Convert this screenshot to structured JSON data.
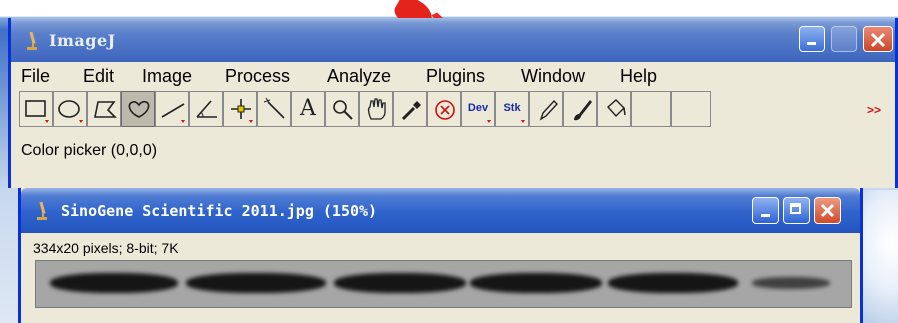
{
  "main_window": {
    "title": "ImageJ",
    "menu": [
      "File",
      "Edit",
      "Image",
      "Process",
      "Analyze",
      "Plugins",
      "Window",
      "Help"
    ],
    "tools": [
      {
        "name": "rectangle-tool",
        "icon": "rectangle-icon",
        "label": ""
      },
      {
        "name": "oval-tool",
        "icon": "oval-icon",
        "label": ""
      },
      {
        "name": "polygon-tool",
        "icon": "polygon-icon",
        "label": ""
      },
      {
        "name": "freehand-tool",
        "icon": "freehand-icon",
        "label": "",
        "active": true
      },
      {
        "name": "line-tool",
        "icon": "line-icon",
        "label": ""
      },
      {
        "name": "angle-tool",
        "icon": "angle-icon",
        "label": ""
      },
      {
        "name": "point-tool",
        "icon": "point-icon",
        "label": ""
      },
      {
        "name": "wand-tool",
        "icon": "wand-icon",
        "label": ""
      },
      {
        "name": "text-tool",
        "icon": "text-icon",
        "label": "A"
      },
      {
        "name": "magnifier-tool",
        "icon": "magnifier-icon",
        "label": ""
      },
      {
        "name": "scroll-tool",
        "icon": "hand-icon",
        "label": ""
      },
      {
        "name": "color-picker-tool",
        "icon": "dropper-icon",
        "label": ""
      },
      {
        "name": "x-tool",
        "icon": "x-circle-icon",
        "label": ""
      },
      {
        "name": "dev-menu",
        "icon": "",
        "label": "Dev"
      },
      {
        "name": "stk-menu",
        "icon": "",
        "label": "Stk"
      },
      {
        "name": "pencil-tool",
        "icon": "pencil-icon",
        "label": ""
      },
      {
        "name": "brush-tool",
        "icon": "brush-icon",
        "label": ""
      },
      {
        "name": "flood-fill-tool",
        "icon": "bucket-icon",
        "label": ""
      },
      {
        "name": "empty-tool-1",
        "icon": "",
        "label": ""
      },
      {
        "name": "empty-tool-2",
        "icon": "",
        "label": ""
      }
    ],
    "more_label": ">>",
    "status": "Color picker (0,0,0)"
  },
  "image_window": {
    "title": "SinoGene Scientific 2011.jpg (150%)",
    "info": "334x20 pixels; 8-bit; 7K"
  },
  "colors": {
    "titlebar_blue": "#3d65bd",
    "window_bg": "#ece9d8",
    "close_red": "#c8462a",
    "watermark_red": "#e3231c"
  }
}
